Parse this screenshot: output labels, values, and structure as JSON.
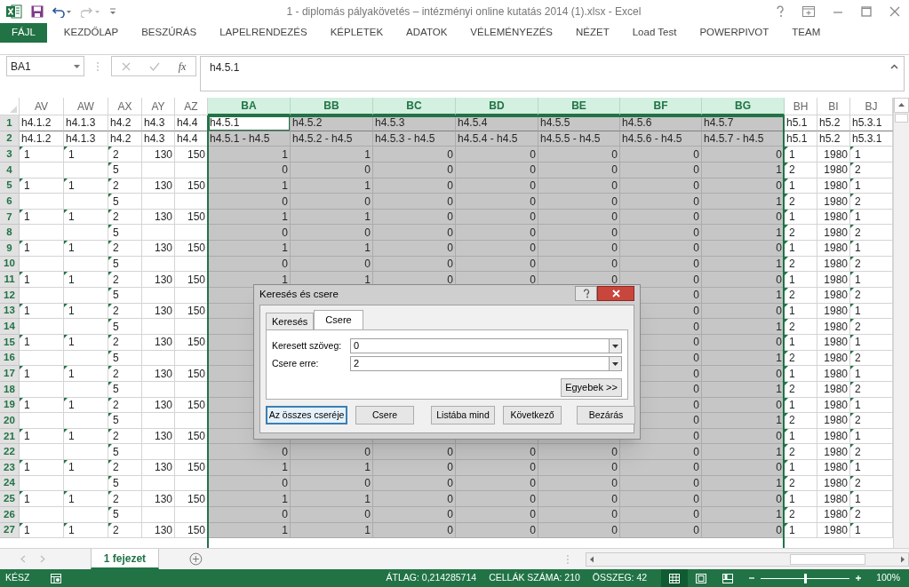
{
  "window": {
    "title": "1 - diplomás pályakövetés – intézményi online kutatás 2014 (1).xlsx - Excel"
  },
  "ribbon_tabs": [
    {
      "label": "FÁJL",
      "kind": "file"
    },
    {
      "label": "KEZDŐLAP",
      "kind": "tab"
    },
    {
      "label": "BESZÚRÁS",
      "kind": "tab"
    },
    {
      "label": "LAPELRENDEZÉS",
      "kind": "tab"
    },
    {
      "label": "KÉPLETEK",
      "kind": "tab"
    },
    {
      "label": "ADATOK",
      "kind": "tab"
    },
    {
      "label": "VÉLEMÉNYEZÉS",
      "kind": "tab"
    },
    {
      "label": "NÉZET",
      "kind": "tab"
    },
    {
      "label": "Load Test",
      "kind": "tab"
    },
    {
      "label": "POWERPIVOT",
      "kind": "tab"
    },
    {
      "label": "TEAM",
      "kind": "tab"
    }
  ],
  "formula_bar": {
    "name_box": "BA1",
    "function_label": "fx",
    "formula": "h4.5.1"
  },
  "columns": [
    {
      "label": "AV",
      "selected": false,
      "active": false,
      "text_numbers": true
    },
    {
      "label": "AW",
      "selected": false,
      "active": false,
      "text_numbers": true
    },
    {
      "label": "AX",
      "selected": false,
      "active": false,
      "text_numbers": true
    },
    {
      "label": "AY",
      "selected": false,
      "active": false,
      "text_numbers": false
    },
    {
      "label": "AZ",
      "selected": false,
      "active": false,
      "text_numbers": false
    },
    {
      "label": "BA",
      "selected": true,
      "active": true,
      "text_numbers": false
    },
    {
      "label": "BB",
      "selected": true,
      "active": false,
      "text_numbers": false
    },
    {
      "label": "BC",
      "selected": true,
      "active": false,
      "text_numbers": false
    },
    {
      "label": "BD",
      "selected": true,
      "active": false,
      "text_numbers": false
    },
    {
      "label": "BE",
      "selected": true,
      "active": false,
      "text_numbers": false
    },
    {
      "label": "BF",
      "selected": true,
      "active": false,
      "text_numbers": false
    },
    {
      "label": "BG",
      "selected": true,
      "active": false,
      "text_numbers": false
    },
    {
      "label": "BH",
      "selected": false,
      "active": false,
      "text_numbers": true
    },
    {
      "label": "BI",
      "selected": false,
      "active": false,
      "text_numbers": false
    },
    {
      "label": "BJ",
      "selected": false,
      "active": false,
      "text_numbers": true
    }
  ],
  "rows": [
    {
      "number": "1",
      "kind": "header",
      "active": true,
      "cells": [
        "h4.1.2",
        "h4.1.3",
        "h4.2",
        "h4.3",
        "h4.4",
        "h4.5.1",
        "h4.5.2",
        "h4.5.3",
        "h4.5.4",
        "h4.5.5",
        "h4.5.6",
        "h4.5.7",
        "h5.1",
        "h5.2",
        "h5.3.1"
      ]
    },
    {
      "number": "2",
      "kind": "header",
      "active": false,
      "cells": [
        "h4.1.2",
        "h4.1.3",
        "h4.2",
        "h4.3",
        "h4.4",
        "h4.5.1 - h4.5",
        "h4.5.2 - h4.5",
        "h4.5.3 - h4.5",
        "h4.5.4 - h4.5",
        "h4.5.5 - h4.5",
        "h4.5.6 - h4.5",
        "h4.5.7 - h4.5",
        "h5.1",
        "h5.2",
        "h5.3.1"
      ]
    },
    {
      "number": "3",
      "kind": "data",
      "active": false,
      "cells": [
        "1",
        "1",
        "2",
        "130",
        "150",
        "1",
        "1",
        "0",
        "0",
        "0",
        "0",
        "0",
        "1",
        "1980",
        "1"
      ]
    },
    {
      "number": "4",
      "kind": "data",
      "active": false,
      "cells": [
        null,
        null,
        "5",
        null,
        null,
        "0",
        "0",
        "0",
        "0",
        "0",
        "0",
        "1",
        "2",
        "1980",
        "2"
      ]
    },
    {
      "number": "5",
      "kind": "data",
      "active": false,
      "cells": [
        "1",
        "1",
        "2",
        "130",
        "150",
        "1",
        "1",
        "0",
        "0",
        "0",
        "0",
        "0",
        "1",
        "1980",
        "1"
      ]
    },
    {
      "number": "6",
      "kind": "data",
      "active": false,
      "cells": [
        null,
        null,
        "5",
        null,
        null,
        "0",
        "0",
        "0",
        "0",
        "0",
        "0",
        "1",
        "2",
        "1980",
        "2"
      ]
    },
    {
      "number": "7",
      "kind": "data",
      "active": false,
      "cells": [
        "1",
        "1",
        "2",
        "130",
        "150",
        "1",
        "1",
        "0",
        "0",
        "0",
        "0",
        "0",
        "1",
        "1980",
        "1"
      ]
    },
    {
      "number": "8",
      "kind": "data",
      "active": false,
      "cells": [
        null,
        null,
        "5",
        null,
        null,
        "0",
        "0",
        "0",
        "0",
        "0",
        "0",
        "1",
        "2",
        "1980",
        "2"
      ]
    },
    {
      "number": "9",
      "kind": "data",
      "active": false,
      "cells": [
        "1",
        "1",
        "2",
        "130",
        "150",
        "1",
        "1",
        "0",
        "0",
        "0",
        "0",
        "0",
        "1",
        "1980",
        "1"
      ]
    },
    {
      "number": "10",
      "kind": "data",
      "active": false,
      "cells": [
        null,
        null,
        "5",
        null,
        null,
        "0",
        "0",
        "0",
        "0",
        "0",
        "0",
        "1",
        "2",
        "1980",
        "2"
      ]
    },
    {
      "number": "11",
      "kind": "data",
      "active": false,
      "cells": [
        "1",
        "1",
        "2",
        "130",
        "150",
        "1",
        "1",
        "0",
        "0",
        "0",
        "0",
        "0",
        "1",
        "1980",
        "1"
      ]
    },
    {
      "number": "12",
      "kind": "data",
      "active": false,
      "cells": [
        null,
        null,
        "5",
        null,
        null,
        null,
        null,
        null,
        null,
        null,
        "0",
        "1",
        "2",
        "1980",
        "2"
      ]
    },
    {
      "number": "13",
      "kind": "data",
      "active": false,
      "cells": [
        "1",
        "1",
        "2",
        "130",
        "150",
        null,
        null,
        null,
        null,
        null,
        "0",
        "0",
        "1",
        "1980",
        "1"
      ]
    },
    {
      "number": "14",
      "kind": "data",
      "active": false,
      "cells": [
        null,
        null,
        "5",
        null,
        null,
        null,
        null,
        null,
        null,
        null,
        "0",
        "1",
        "2",
        "1980",
        "2"
      ]
    },
    {
      "number": "15",
      "kind": "data",
      "active": false,
      "cells": [
        "1",
        "1",
        "2",
        "130",
        "150",
        null,
        null,
        null,
        null,
        null,
        "0",
        "0",
        "1",
        "1980",
        "1"
      ]
    },
    {
      "number": "16",
      "kind": "data",
      "active": false,
      "cells": [
        null,
        null,
        "5",
        null,
        null,
        null,
        null,
        null,
        null,
        null,
        "0",
        "1",
        "2",
        "1980",
        "2"
      ]
    },
    {
      "number": "17",
      "kind": "data",
      "active": false,
      "cells": [
        "1",
        "1",
        "2",
        "130",
        "150",
        null,
        null,
        null,
        null,
        null,
        "0",
        "0",
        "1",
        "1980",
        "1"
      ]
    },
    {
      "number": "18",
      "kind": "data",
      "active": false,
      "cells": [
        null,
        null,
        "5",
        null,
        null,
        null,
        null,
        null,
        null,
        null,
        "0",
        "1",
        "2",
        "1980",
        "2"
      ]
    },
    {
      "number": "19",
      "kind": "data",
      "active": false,
      "cells": [
        "1",
        "1",
        "2",
        "130",
        "150",
        null,
        null,
        null,
        null,
        null,
        "0",
        "0",
        "1",
        "1980",
        "1"
      ]
    },
    {
      "number": "20",
      "kind": "data",
      "active": false,
      "cells": [
        null,
        null,
        "5",
        null,
        null,
        null,
        null,
        null,
        null,
        null,
        "0",
        "1",
        "2",
        "1980",
        "2"
      ]
    },
    {
      "number": "21",
      "kind": "data",
      "active": false,
      "cells": [
        "1",
        "1",
        "2",
        "130",
        "150",
        null,
        null,
        null,
        null,
        null,
        "0",
        "0",
        "1",
        "1980",
        "1"
      ]
    },
    {
      "number": "22",
      "kind": "data",
      "active": false,
      "cells": [
        null,
        null,
        "5",
        null,
        null,
        "0",
        "0",
        "0",
        "0",
        "0",
        "0",
        "1",
        "2",
        "1980",
        "2"
      ]
    },
    {
      "number": "23",
      "kind": "data",
      "active": false,
      "cells": [
        "1",
        "1",
        "2",
        "130",
        "150",
        "1",
        "1",
        "0",
        "0",
        "0",
        "0",
        "0",
        "1",
        "1980",
        "1"
      ]
    },
    {
      "number": "24",
      "kind": "data",
      "active": false,
      "cells": [
        null,
        null,
        "5",
        null,
        null,
        "0",
        "0",
        "0",
        "0",
        "0",
        "0",
        "1",
        "2",
        "1980",
        "2"
      ]
    },
    {
      "number": "25",
      "kind": "data",
      "active": false,
      "cells": [
        "1",
        "1",
        "2",
        "130",
        "150",
        "1",
        "1",
        "0",
        "0",
        "0",
        "0",
        "0",
        "1",
        "1980",
        "1"
      ]
    },
    {
      "number": "26",
      "kind": "data",
      "active": false,
      "cells": [
        null,
        null,
        "5",
        null,
        null,
        "0",
        "0",
        "0",
        "0",
        "0",
        "0",
        "1",
        "2",
        "1980",
        "2"
      ]
    },
    {
      "number": "27",
      "kind": "data",
      "active": false,
      "cells": [
        "1",
        "1",
        "2",
        "130",
        "150",
        "1",
        "1",
        "0",
        "0",
        "0",
        "0",
        "0",
        "1",
        "1980",
        "1"
      ]
    }
  ],
  "sheet_tabs": [
    {
      "label": "1 fejezet",
      "selected": true
    }
  ],
  "dialog": {
    "title": "Keresés és csere",
    "tabs": [
      {
        "label": "Keresés",
        "selected": false
      },
      {
        "label": "Csere",
        "selected": true
      }
    ],
    "fields": [
      {
        "label": "Keresett szöveg:",
        "value": "0"
      },
      {
        "label": "Csere erre:",
        "value": "2"
      }
    ],
    "options_button": "Egyebek >>",
    "buttons": [
      {
        "label": "Az összes cseréje",
        "focused": true
      },
      {
        "label": "Csere",
        "focused": false
      },
      {
        "label": "Listába mind",
        "focused": false
      },
      {
        "label": "Következő",
        "focused": false
      },
      {
        "label": "Bezárás",
        "focused": false
      }
    ]
  },
  "status_bar": {
    "mode": "KÉSZ",
    "stats": [
      "ÁTLAG: 0,214285714",
      "CELLÁK SZÁMA: 210",
      "ÖSSZEG: 42"
    ],
    "views": [
      {
        "kind": "normal",
        "selected": true
      },
      {
        "kind": "page_layout",
        "selected": false
      },
      {
        "kind": "page_break",
        "selected": false
      }
    ],
    "zoom": {
      "level": 0.5,
      "label": "100%"
    }
  }
}
